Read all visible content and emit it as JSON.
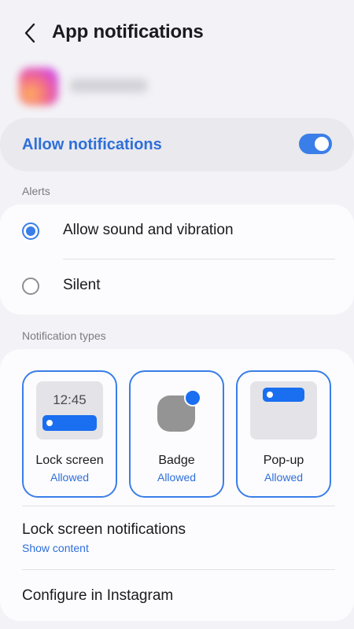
{
  "header": {
    "title": "App notifications",
    "back_icon": "chevron-left-icon"
  },
  "app": {
    "name": "Instagram",
    "name_visible": "blurred"
  },
  "allow": {
    "label": "Allow notifications",
    "enabled": true,
    "accent": "#3a7ee8"
  },
  "alerts": {
    "section_label": "Alerts",
    "options": [
      {
        "label": "Allow sound and vibration",
        "selected": true
      },
      {
        "label": "Silent",
        "selected": false
      }
    ]
  },
  "notification_types": {
    "section_label": "Notification types",
    "tiles": [
      {
        "name": "Lock screen",
        "status": "Allowed",
        "preview_time": "12:45"
      },
      {
        "name": "Badge",
        "status": "Allowed"
      },
      {
        "name": "Pop-up",
        "status": "Allowed"
      }
    ]
  },
  "rows": {
    "lock_screen": {
      "title": "Lock screen notifications",
      "subtitle": "Show content"
    },
    "configure": {
      "title": "Configure in Instagram"
    }
  }
}
